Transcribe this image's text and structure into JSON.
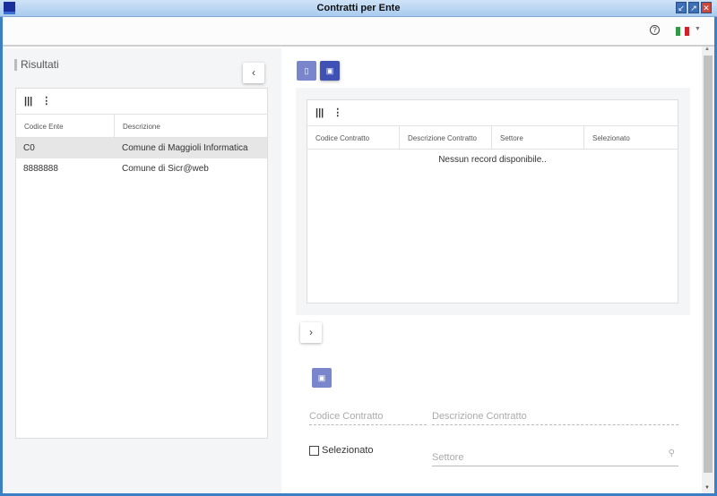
{
  "window": {
    "title": "Contratti per Ente",
    "controls": [
      "restore",
      "maximize",
      "close"
    ]
  },
  "header": {
    "help_icon": "question-circle-icon",
    "language": "it",
    "flag_colors": [
      "#2e9a46",
      "#ffffff",
      "#d2232c"
    ]
  },
  "left": {
    "section_title": "Risultati",
    "collapse_label": "‹",
    "grid": {
      "columns": [
        "Codice Ente",
        "Descrizione"
      ],
      "rows": [
        {
          "codice": "C0",
          "descrizione": "Comune di Maggioli Informatica",
          "selected": true
        },
        {
          "codice": "8888888",
          "descrizione": "Comune di Sicr@web",
          "selected": false
        }
      ]
    }
  },
  "right": {
    "toolbar": {
      "new_icon": "new-document-icon",
      "save_icon": "save-icon"
    },
    "grid": {
      "columns": [
        "Codice Contratto",
        "Descrizione Contratto",
        "Settore",
        "Selezionato"
      ],
      "empty_text": "Nessun record disponibile.."
    },
    "expand_label": "›",
    "form": {
      "codice_contratto_placeholder": "Codice Contratto",
      "descrizione_contratto_placeholder": "Descrizione Contratto",
      "selezionato_label": "Selezionato",
      "selezionato_checked": false,
      "settore_placeholder": "Settore"
    }
  },
  "colors": {
    "primary": "#3f51b5",
    "primary_light": "#7986cb"
  }
}
